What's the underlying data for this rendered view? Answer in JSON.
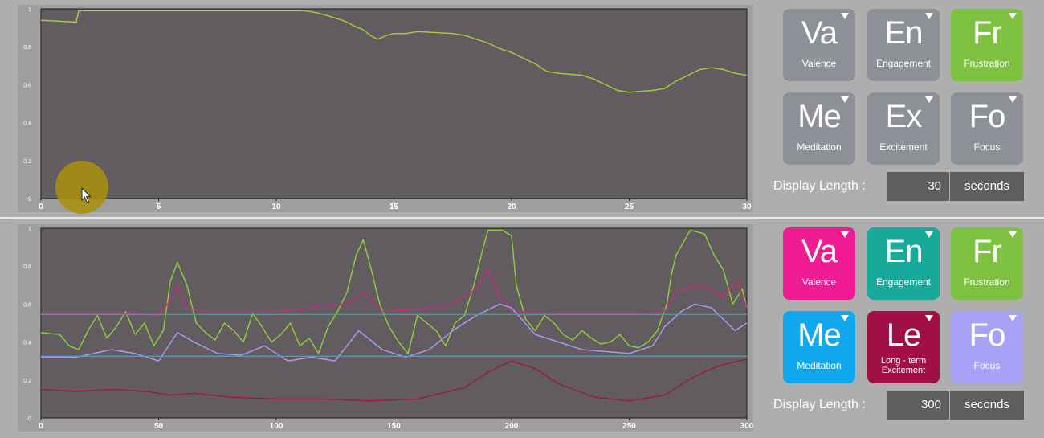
{
  "top_panel": {
    "chart_data": {
      "type": "line",
      "x_ticks": [
        "0",
        "5",
        "10",
        "15",
        "20",
        "25",
        "30"
      ],
      "y_ticks": [
        "0",
        "0.2",
        "0.4",
        "0.6",
        "0.8",
        "1"
      ],
      "xlim": [
        0,
        30
      ],
      "ylim": [
        0,
        1
      ],
      "series": [
        {
          "color": "#9fd23c",
          "x": [
            0,
            1.5,
            1.6,
            11.2,
            11.7,
            12.0,
            12.3,
            12.8,
            13.0,
            13.3,
            13.7,
            14.0,
            14.3,
            14.7,
            15.0,
            15.5,
            16.0,
            17.5,
            18.0,
            18.5,
            19.0,
            19.5,
            20.0,
            20.5,
            21.0,
            21.5,
            22.0,
            23.0,
            23.5,
            24.0,
            24.5,
            25.0,
            26.0,
            26.5,
            27.0,
            27.5,
            28.0,
            28.5,
            29.0,
            29.5,
            30.0
          ],
          "y": [
            0.94,
            0.93,
            0.99,
            0.99,
            0.98,
            0.97,
            0.96,
            0.94,
            0.93,
            0.91,
            0.89,
            0.86,
            0.84,
            0.86,
            0.87,
            0.87,
            0.88,
            0.87,
            0.86,
            0.84,
            0.82,
            0.79,
            0.77,
            0.74,
            0.71,
            0.67,
            0.66,
            0.65,
            0.63,
            0.6,
            0.57,
            0.56,
            0.57,
            0.58,
            0.62,
            0.65,
            0.68,
            0.69,
            0.68,
            0.66,
            0.65
          ]
        }
      ]
    },
    "tiles": [
      {
        "symbol": "Va",
        "label": "Valence",
        "color": "#8e9098"
      },
      {
        "symbol": "En",
        "label": "Engagement",
        "color": "#8e9098"
      },
      {
        "symbol": "Fr",
        "label": "Frustration",
        "color": "#7ec140"
      },
      {
        "symbol": "Me",
        "label": "Meditation",
        "color": "#8e9098"
      },
      {
        "symbol": "Ex",
        "label": "Excitement",
        "color": "#8e9098"
      },
      {
        "symbol": "Fo",
        "label": "Focus",
        "color": "#8e9098"
      }
    ],
    "display_length": {
      "label": "Display Length :",
      "value": "30",
      "unit": "seconds"
    }
  },
  "bottom_panel": {
    "chart_data": {
      "type": "line",
      "x_ticks": [
        "0",
        "50",
        "100",
        "150",
        "200",
        "250",
        "300"
      ],
      "y_ticks": [
        "0",
        "0.2",
        "0.4",
        "0.6",
        "0.8",
        "1"
      ],
      "xlim": [
        0,
        300
      ],
      "ylim": [
        0,
        1
      ],
      "series": [
        {
          "color": "#8fd03c",
          "x": [
            0,
            8,
            12,
            16,
            20,
            24,
            28,
            32,
            36,
            40,
            44,
            48,
            52,
            55,
            58,
            62,
            66,
            70,
            74,
            78,
            82,
            86,
            90,
            94,
            98,
            102,
            106,
            110,
            114,
            118,
            122,
            126,
            130,
            134,
            137,
            140,
            144,
            148,
            152,
            156,
            160,
            164,
            168,
            172,
            176,
            180,
            184,
            188,
            190,
            196,
            200,
            202,
            206,
            210,
            214,
            218,
            222,
            226,
            230,
            234,
            238,
            242,
            246,
            250,
            254,
            258,
            262,
            266,
            268,
            270,
            276,
            282,
            286,
            290,
            294,
            298,
            300
          ],
          "y": [
            0.45,
            0.44,
            0.38,
            0.36,
            0.46,
            0.54,
            0.42,
            0.48,
            0.56,
            0.44,
            0.5,
            0.38,
            0.46,
            0.72,
            0.82,
            0.7,
            0.5,
            0.45,
            0.41,
            0.5,
            0.46,
            0.4,
            0.55,
            0.48,
            0.4,
            0.44,
            0.5,
            0.38,
            0.42,
            0.34,
            0.48,
            0.56,
            0.66,
            0.86,
            0.94,
            0.8,
            0.6,
            0.48,
            0.4,
            0.34,
            0.54,
            0.5,
            0.46,
            0.38,
            0.5,
            0.54,
            0.7,
            0.9,
            0.99,
            0.99,
            0.96,
            0.7,
            0.52,
            0.46,
            0.54,
            0.5,
            0.44,
            0.41,
            0.46,
            0.42,
            0.39,
            0.4,
            0.44,
            0.38,
            0.37,
            0.4,
            0.46,
            0.6,
            0.76,
            0.86,
            0.99,
            0.97,
            0.86,
            0.78,
            0.6,
            0.68,
            0.58
          ]
        },
        {
          "color": "#c82a80",
          "x": [
            0,
            20,
            40,
            50,
            55,
            58,
            62,
            70,
            100,
            130,
            137,
            145,
            160,
            175,
            185,
            190,
            195,
            200,
            220,
            255,
            265,
            270,
            280,
            290,
            296,
            300
          ],
          "y": [
            0.55,
            0.55,
            0.55,
            0.54,
            0.62,
            0.7,
            0.58,
            0.56,
            0.56,
            0.6,
            0.66,
            0.56,
            0.57,
            0.6,
            0.68,
            0.78,
            0.64,
            0.56,
            0.55,
            0.55,
            0.56,
            0.66,
            0.7,
            0.64,
            0.72,
            0.58
          ]
        },
        {
          "color": "#a8a0f0",
          "x": [
            0,
            15,
            30,
            40,
            50,
            58,
            65,
            75,
            85,
            95,
            105,
            115,
            125,
            135,
            145,
            155,
            165,
            175,
            185,
            195,
            200,
            210,
            220,
            230,
            240,
            250,
            260,
            265,
            272,
            278,
            285,
            290,
            295,
            300
          ],
          "y": [
            0.32,
            0.32,
            0.36,
            0.34,
            0.3,
            0.45,
            0.4,
            0.34,
            0.33,
            0.38,
            0.3,
            0.32,
            0.3,
            0.46,
            0.36,
            0.32,
            0.36,
            0.46,
            0.54,
            0.6,
            0.58,
            0.44,
            0.4,
            0.36,
            0.35,
            0.34,
            0.38,
            0.48,
            0.56,
            0.6,
            0.58,
            0.52,
            0.46,
            0.5
          ]
        },
        {
          "color": "#9a1848",
          "x": [
            0,
            15,
            30,
            45,
            55,
            65,
            80,
            100,
            120,
            140,
            160,
            180,
            190,
            200,
            210,
            220,
            235,
            250,
            265,
            275,
            285,
            290,
            300
          ],
          "y": [
            0.15,
            0.14,
            0.15,
            0.14,
            0.12,
            0.13,
            0.11,
            0.1,
            0.1,
            0.09,
            0.1,
            0.16,
            0.24,
            0.3,
            0.26,
            0.18,
            0.11,
            0.09,
            0.12,
            0.2,
            0.26,
            0.28,
            0.31
          ]
        },
        {
          "color": "#18b4a8",
          "x": [
            0,
            300
          ],
          "y": [
            0.545,
            0.545
          ]
        },
        {
          "color": "#2aa8e8",
          "x": [
            0,
            300
          ],
          "y": [
            0.325,
            0.325
          ]
        }
      ]
    },
    "tiles": [
      {
        "symbol": "Va",
        "label": "Valence",
        "color": "#ee1b92"
      },
      {
        "symbol": "En",
        "label": "Engagement",
        "color": "#17aa9b"
      },
      {
        "symbol": "Fr",
        "label": "Frustration",
        "color": "#7ec140"
      },
      {
        "symbol": "Me",
        "label": "Meditation",
        "color": "#0fa8ee"
      },
      {
        "symbol": "Le",
        "label": "Long - term Excitement",
        "color": "#a10f45"
      },
      {
        "symbol": "Fo",
        "label": "Focus",
        "color": "#a7a2f5"
      }
    ],
    "display_length": {
      "label": "Display Length :",
      "value": "300",
      "unit": "seconds"
    }
  }
}
